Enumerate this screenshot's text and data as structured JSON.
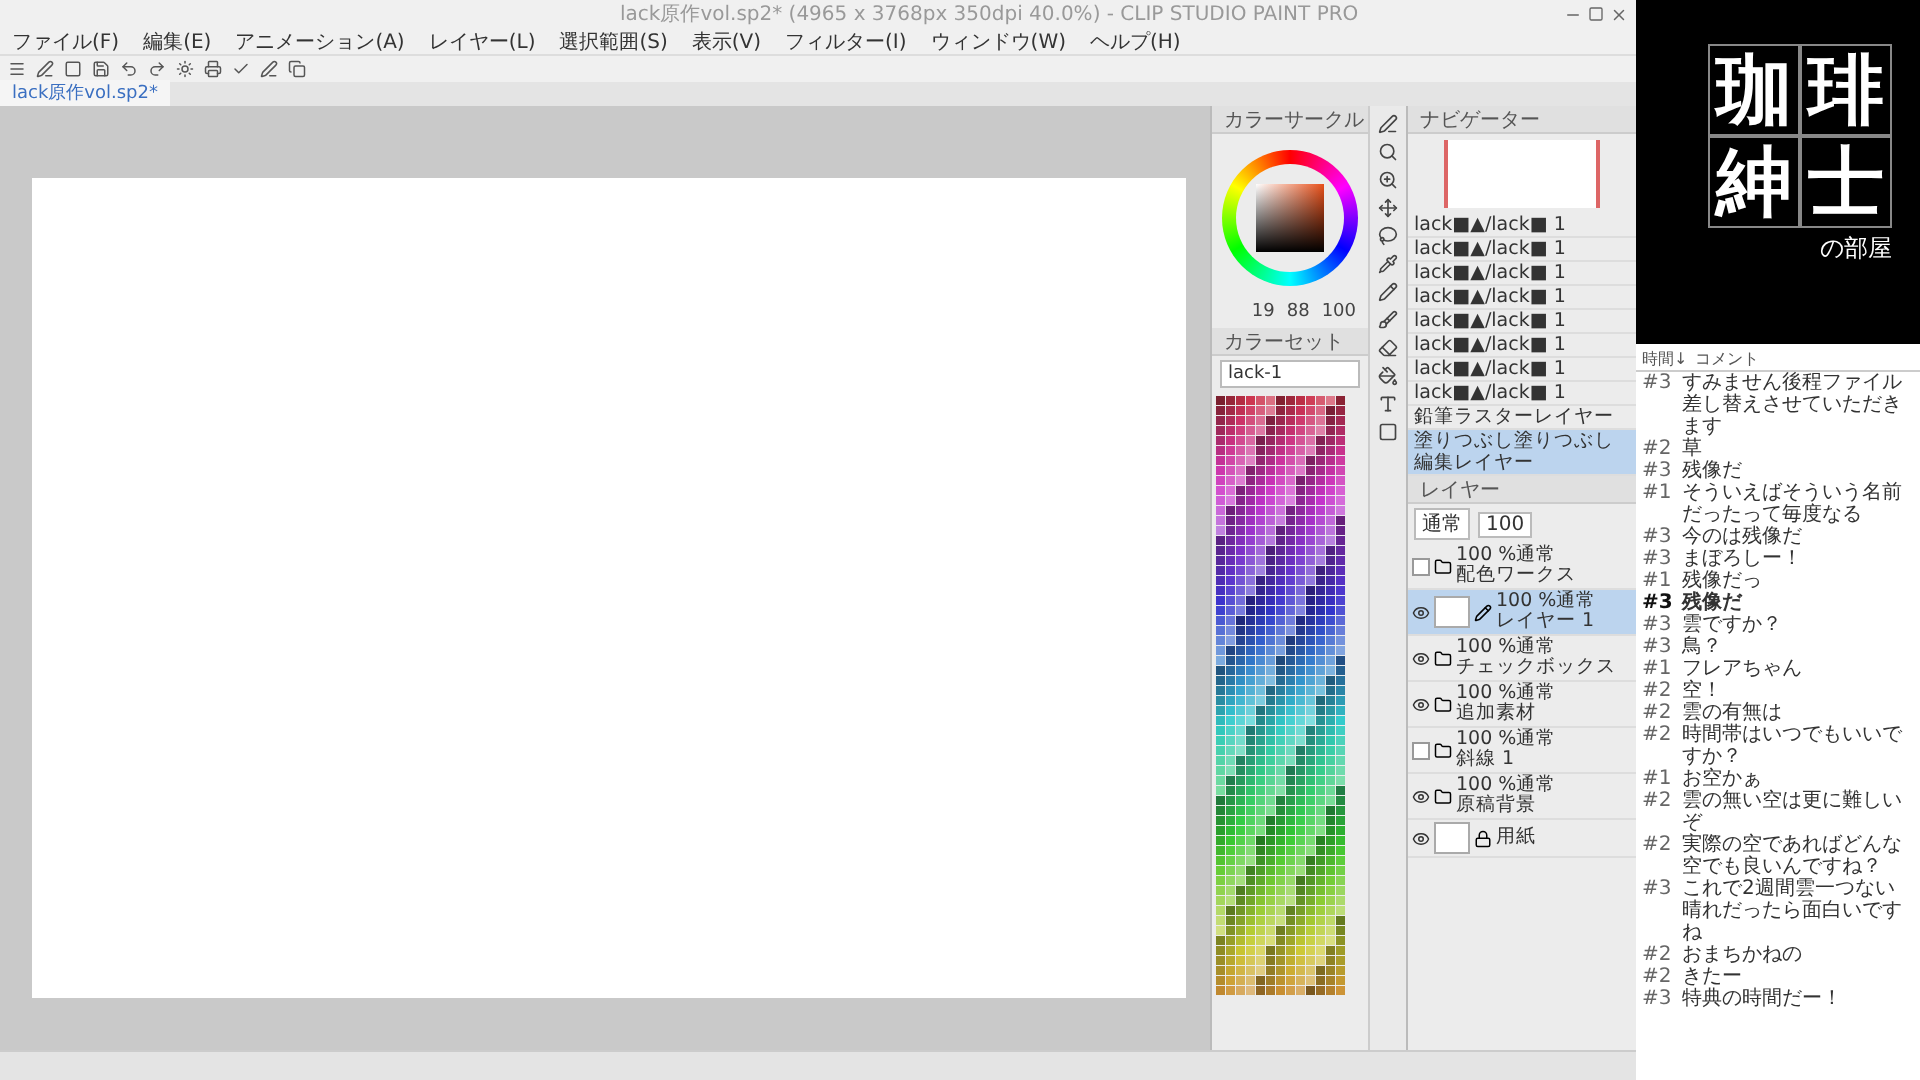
{
  "window": {
    "title": "lack原作vol.sp2* (4965 x 3768px 350dpi 40.0%) - CLIP STUDIO PAINT PRO"
  },
  "menu": [
    "ファイル(F)",
    "編集(E)",
    "アニメーション(A)",
    "レイヤー(L)",
    "選択範囲(S)",
    "表示(V)",
    "フィルター(I)",
    "ウィンドウ(W)",
    "ヘルプ(H)"
  ],
  "document_tab": {
    "label": "lack原作vol.sp2*",
    "selected": true
  },
  "color_circle": {
    "title": "カラーサークル",
    "readouts": [
      "19",
      "88",
      "100"
    ]
  },
  "color_set": {
    "title": "カラーセット",
    "set_name": "lack-1"
  },
  "navigator": {
    "title": "ナビゲーター"
  },
  "layer_property": {
    "rows": [
      {
        "label": "lack■▲/lack■ 1",
        "selected": false
      },
      {
        "label": "lack■▲/lack■ 1",
        "selected": false
      },
      {
        "label": "lack■▲/lack■ 1",
        "selected": false
      },
      {
        "label": "lack■▲/lack■ 1",
        "selected": false
      },
      {
        "label": "lack■▲/lack■ 1",
        "selected": false
      },
      {
        "label": "lack■▲/lack■ 1",
        "selected": false
      },
      {
        "label": "lack■▲/lack■ 1",
        "selected": false
      },
      {
        "label": "lack■▲/lack■ 1",
        "selected": false
      },
      {
        "label": "鉛筆ラスターレイヤー",
        "selected": false
      },
      {
        "label": "塗りつぶし塗りつぶし編集レイヤー",
        "selected": true
      }
    ]
  },
  "layers": {
    "title": "レイヤー",
    "blend_mode": "通常",
    "opacity": "100",
    "items": [
      {
        "kind": "folder",
        "info": "100 %通常",
        "name": "配色ワークス",
        "visible": false,
        "selected": false
      },
      {
        "kind": "raster",
        "info": "100 %通常",
        "name": "レイヤー 1",
        "visible": true,
        "selected": true
      },
      {
        "kind": "folder",
        "info": "100 %通常",
        "name": "チェックボックス",
        "visible": true,
        "selected": false
      },
      {
        "kind": "folder",
        "info": "100 %通常",
        "name": "追加素材",
        "visible": true,
        "selected": false
      },
      {
        "kind": "folder",
        "info": "100 %通常",
        "name": "斜線 1",
        "visible": false,
        "selected": false
      },
      {
        "kind": "folder",
        "info": "100 %通常",
        "name": "原稿背景",
        "visible": true,
        "selected": false
      },
      {
        "kind": "paper",
        "name": "用紙",
        "visible": true,
        "selected": false
      }
    ]
  },
  "logo": {
    "characters": [
      "珈",
      "琲",
      "紳",
      "士"
    ],
    "subtitle": "の部屋"
  },
  "comments": {
    "columns": [
      "時間↓",
      "コメント"
    ],
    "rows": [
      {
        "user": "#3",
        "text": "すみません後程ファイル差し替えさせていただきます",
        "highlighted": false
      },
      {
        "user": "#2",
        "text": "草",
        "highlighted": false
      },
      {
        "user": "#3",
        "text": "残像だ",
        "highlighted": false
      },
      {
        "user": "#1",
        "text": "そういえばそういう名前だったって毎度なる",
        "highlighted": false
      },
      {
        "user": "#3",
        "text": "今のは残像だ",
        "highlighted": false
      },
      {
        "user": "#3",
        "text": "まぼろしー！",
        "highlighted": false
      },
      {
        "user": "#1",
        "text": "残像だっ",
        "highlighted": false
      },
      {
        "user": "#3",
        "text": "残像だ",
        "highlighted": true
      },
      {
        "user": "#3",
        "text": "雲ですか？",
        "highlighted": false
      },
      {
        "user": "#3",
        "text": "鳥？",
        "highlighted": false
      },
      {
        "user": "#1",
        "text": "フレアちゃん",
        "highlighted": false
      },
      {
        "user": "#2",
        "text": "空！",
        "highlighted": false
      },
      {
        "user": "#2",
        "text": "雲の有無は",
        "highlighted": false
      },
      {
        "user": "#2",
        "text": "時間帯はいつでもいいですか？",
        "highlighted": false
      },
      {
        "user": "#1",
        "text": "お空かぁ",
        "highlighted": false
      },
      {
        "user": "#2",
        "text": "雲の無い空は更に難しいぞ",
        "highlighted": false
      },
      {
        "user": "#2",
        "text": "実際の空であればどんな空でも良いんですね？",
        "highlighted": false
      },
      {
        "user": "#3",
        "text": "これで2週間雲一つない晴れだったら面白いですね",
        "highlighted": false
      },
      {
        "user": "#2",
        "text": "おまちかねの",
        "highlighted": false
      },
      {
        "user": "#2",
        "text": "きたー",
        "highlighted": false
      },
      {
        "user": "#3",
        "text": "特典の時間だー！",
        "highlighted": false
      }
    ]
  }
}
